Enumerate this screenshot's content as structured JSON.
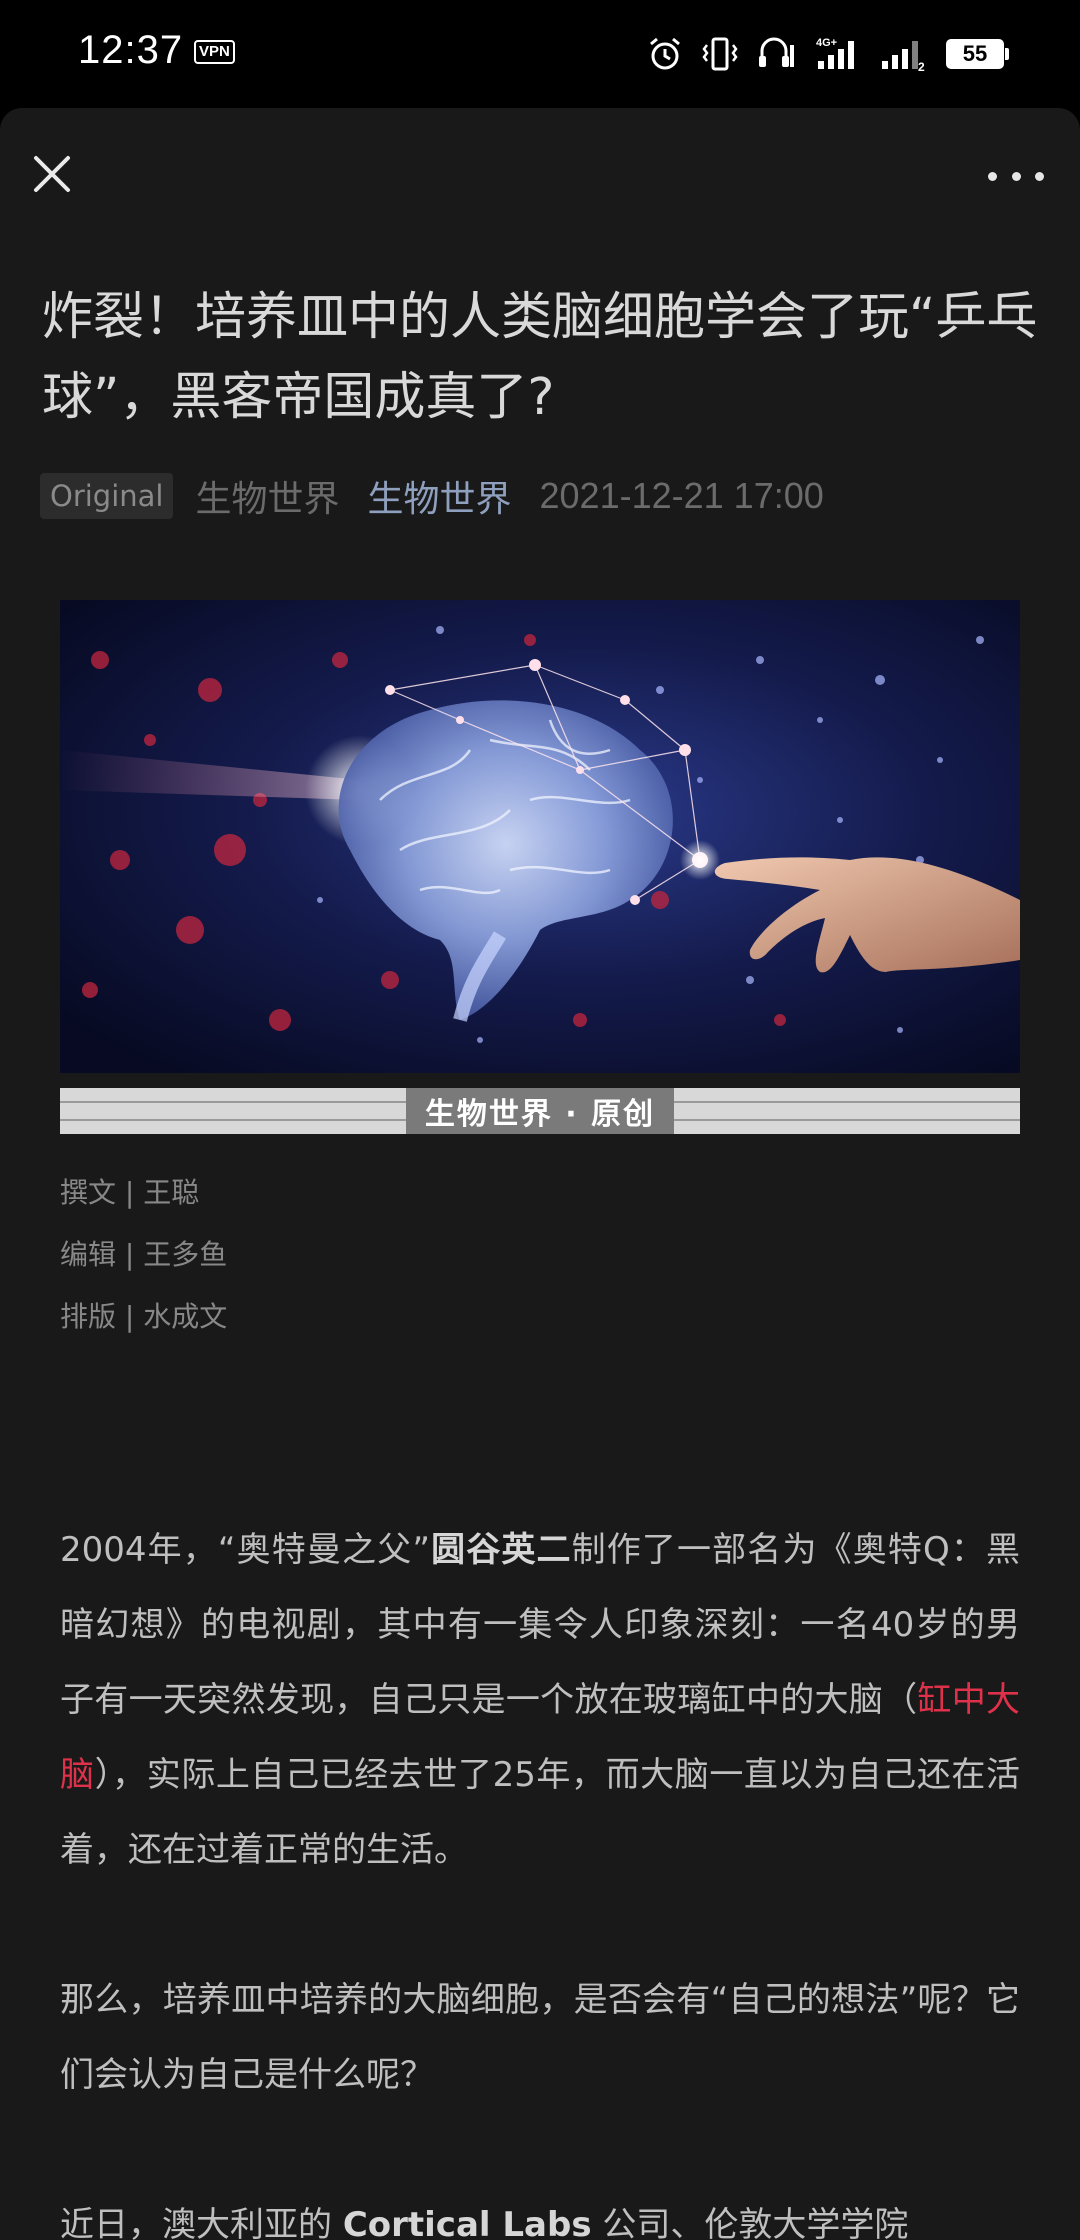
{
  "status_bar": {
    "time": "12:37",
    "vpn": "VPN",
    "network_label": "4G+",
    "sim2_label": "2",
    "battery": "55"
  },
  "toolbar": {
    "close_icon": "close-icon",
    "more_icon": "more-horizontal-icon"
  },
  "article": {
    "title": "炸裂！培养皿中的人类脑细胞学会了玩“乒乓球”，黑客帝国成真了?",
    "tag": "Original",
    "author": "生物世界",
    "account": "生物世界",
    "date": "2021-12-21 17:00",
    "hero_image": "brain-network-hand-image",
    "banner_label": "生物世界 · 原创",
    "credits": {
      "writer": "撰文 | 王聪",
      "editor": "编辑 | 王多鱼",
      "layout": "排版 | 水成文"
    },
    "paragraphs": {
      "p1_a": "2004年，“奥特曼之父”",
      "p1_bold": "圆谷英二",
      "p1_b": "制作了一部名为《奥特Q：黑暗幻想》的电视剧，其中有一集令人印象深刻：一名40岁的男子有一天突然发现，自己只是一个放在玻璃缸中的大脑（",
      "p1_red": "缸中大脑",
      "p1_c": "），实际上自己已经去世了25年，而大脑一直以为自己还在活着，还在过着正常的生活。",
      "p2": "那么，培养皿中培养的大脑细胞，是否会有“自己的想法”呢？它们会认为自己是什么呢？",
      "p3_a": "近日，澳大利亚的 ",
      "p3_bold": "Cortical Labs",
      "p3_b": " 公司、伦敦大学学院"
    }
  },
  "colors": {
    "background": "#191919",
    "accent_link": "#8ea0bd",
    "highlight_red": "#e0314b"
  }
}
